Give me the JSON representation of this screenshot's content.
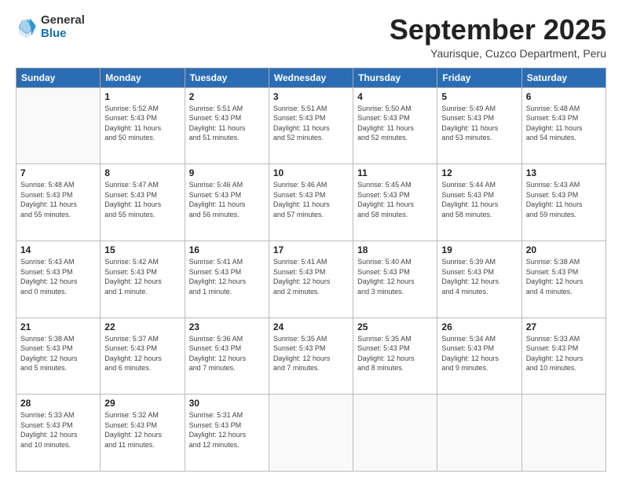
{
  "logo": {
    "general": "General",
    "blue": "Blue"
  },
  "title": "September 2025",
  "location": "Yaurisque, Cuzco Department, Peru",
  "weekdays": [
    "Sunday",
    "Monday",
    "Tuesday",
    "Wednesday",
    "Thursday",
    "Friday",
    "Saturday"
  ],
  "weeks": [
    [
      {
        "day": "",
        "info": ""
      },
      {
        "day": "1",
        "info": "Sunrise: 5:52 AM\nSunset: 5:43 PM\nDaylight: 11 hours\nand 50 minutes."
      },
      {
        "day": "2",
        "info": "Sunrise: 5:51 AM\nSunset: 5:43 PM\nDaylight: 11 hours\nand 51 minutes."
      },
      {
        "day": "3",
        "info": "Sunrise: 5:51 AM\nSunset: 5:43 PM\nDaylight: 11 hours\nand 52 minutes."
      },
      {
        "day": "4",
        "info": "Sunrise: 5:50 AM\nSunset: 5:43 PM\nDaylight: 11 hours\nand 52 minutes."
      },
      {
        "day": "5",
        "info": "Sunrise: 5:49 AM\nSunset: 5:43 PM\nDaylight: 11 hours\nand 53 minutes."
      },
      {
        "day": "6",
        "info": "Sunrise: 5:48 AM\nSunset: 5:43 PM\nDaylight: 11 hours\nand 54 minutes."
      }
    ],
    [
      {
        "day": "7",
        "info": "Sunrise: 5:48 AM\nSunset: 5:43 PM\nDaylight: 11 hours\nand 55 minutes."
      },
      {
        "day": "8",
        "info": "Sunrise: 5:47 AM\nSunset: 5:43 PM\nDaylight: 11 hours\nand 55 minutes."
      },
      {
        "day": "9",
        "info": "Sunrise: 5:46 AM\nSunset: 5:43 PM\nDaylight: 11 hours\nand 56 minutes."
      },
      {
        "day": "10",
        "info": "Sunrise: 5:46 AM\nSunset: 5:43 PM\nDaylight: 11 hours\nand 57 minutes."
      },
      {
        "day": "11",
        "info": "Sunrise: 5:45 AM\nSunset: 5:43 PM\nDaylight: 11 hours\nand 58 minutes."
      },
      {
        "day": "12",
        "info": "Sunrise: 5:44 AM\nSunset: 5:43 PM\nDaylight: 11 hours\nand 58 minutes."
      },
      {
        "day": "13",
        "info": "Sunrise: 5:43 AM\nSunset: 5:43 PM\nDaylight: 11 hours\nand 59 minutes."
      }
    ],
    [
      {
        "day": "14",
        "info": "Sunrise: 5:43 AM\nSunset: 5:43 PM\nDaylight: 12 hours\nand 0 minutes."
      },
      {
        "day": "15",
        "info": "Sunrise: 5:42 AM\nSunset: 5:43 PM\nDaylight: 12 hours\nand 1 minute."
      },
      {
        "day": "16",
        "info": "Sunrise: 5:41 AM\nSunset: 5:43 PM\nDaylight: 12 hours\nand 1 minute."
      },
      {
        "day": "17",
        "info": "Sunrise: 5:41 AM\nSunset: 5:43 PM\nDaylight: 12 hours\nand 2 minutes."
      },
      {
        "day": "18",
        "info": "Sunrise: 5:40 AM\nSunset: 5:43 PM\nDaylight: 12 hours\nand 3 minutes."
      },
      {
        "day": "19",
        "info": "Sunrise: 5:39 AM\nSunset: 5:43 PM\nDaylight: 12 hours\nand 4 minutes."
      },
      {
        "day": "20",
        "info": "Sunrise: 5:38 AM\nSunset: 5:43 PM\nDaylight: 12 hours\nand 4 minutes."
      }
    ],
    [
      {
        "day": "21",
        "info": "Sunrise: 5:38 AM\nSunset: 5:43 PM\nDaylight: 12 hours\nand 5 minutes."
      },
      {
        "day": "22",
        "info": "Sunrise: 5:37 AM\nSunset: 5:43 PM\nDaylight: 12 hours\nand 6 minutes."
      },
      {
        "day": "23",
        "info": "Sunrise: 5:36 AM\nSunset: 5:43 PM\nDaylight: 12 hours\nand 7 minutes."
      },
      {
        "day": "24",
        "info": "Sunrise: 5:35 AM\nSunset: 5:43 PM\nDaylight: 12 hours\nand 7 minutes."
      },
      {
        "day": "25",
        "info": "Sunrise: 5:35 AM\nSunset: 5:43 PM\nDaylight: 12 hours\nand 8 minutes."
      },
      {
        "day": "26",
        "info": "Sunrise: 5:34 AM\nSunset: 5:43 PM\nDaylight: 12 hours\nand 9 minutes."
      },
      {
        "day": "27",
        "info": "Sunrise: 5:33 AM\nSunset: 5:43 PM\nDaylight: 12 hours\nand 10 minutes."
      }
    ],
    [
      {
        "day": "28",
        "info": "Sunrise: 5:33 AM\nSunset: 5:43 PM\nDaylight: 12 hours\nand 10 minutes."
      },
      {
        "day": "29",
        "info": "Sunrise: 5:32 AM\nSunset: 5:43 PM\nDaylight: 12 hours\nand 11 minutes."
      },
      {
        "day": "30",
        "info": "Sunrise: 5:31 AM\nSunset: 5:43 PM\nDaylight: 12 hours\nand 12 minutes."
      },
      {
        "day": "",
        "info": ""
      },
      {
        "day": "",
        "info": ""
      },
      {
        "day": "",
        "info": ""
      },
      {
        "day": "",
        "info": ""
      }
    ]
  ]
}
